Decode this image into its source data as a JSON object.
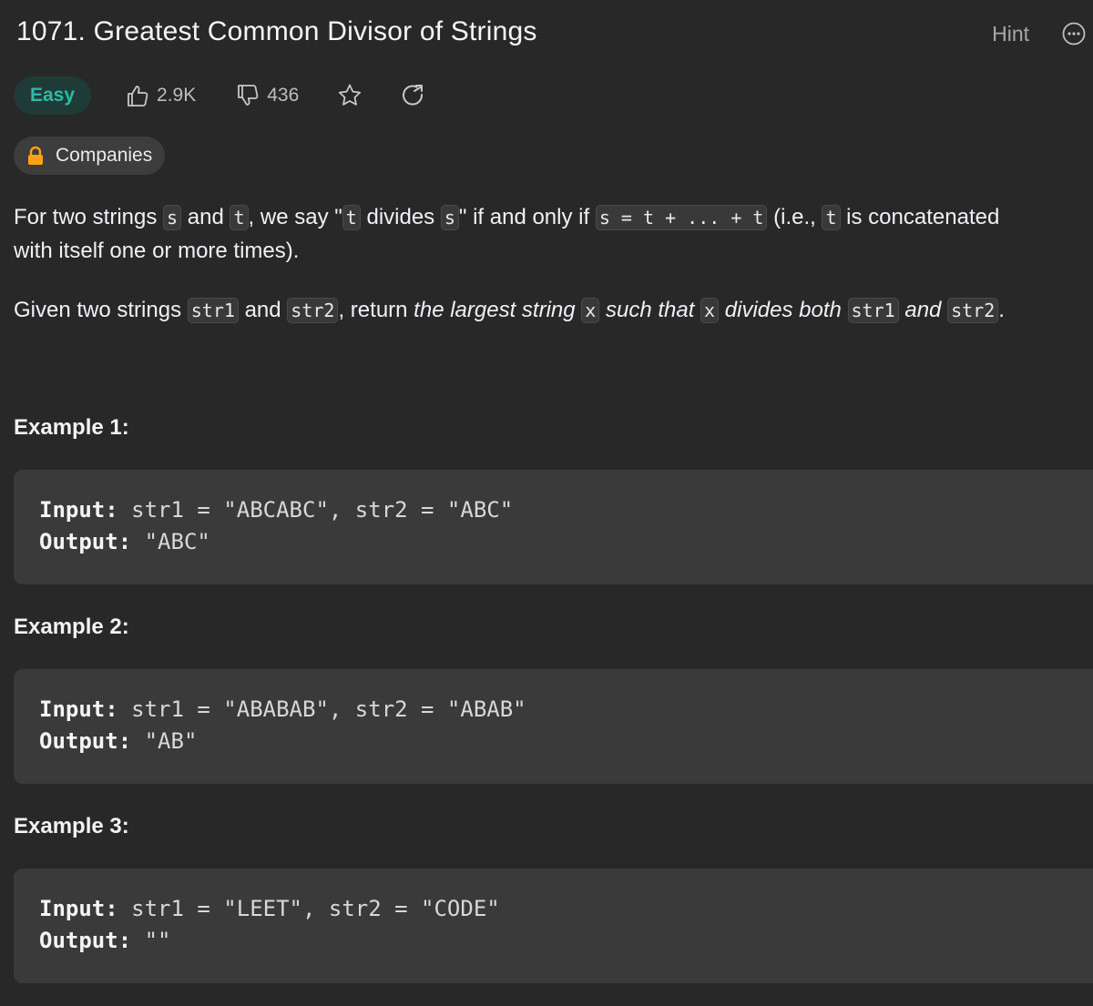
{
  "header": {
    "title": "1071. Greatest Common Divisor of Strings",
    "hint_label": "Hint",
    "more_icon": "more-icon"
  },
  "meta": {
    "difficulty": "Easy",
    "likes": "2.9K",
    "dislikes": "436",
    "icons": [
      "thumbs-up-icon",
      "thumbs-down-icon",
      "star-icon",
      "share-icon"
    ],
    "companies_label": "Companies",
    "colors": {
      "easy_text": "#2cbba6",
      "easy_bg": "#1f3b37",
      "lock": "#ffa116"
    }
  },
  "description": {
    "p1": [
      "For two strings ",
      "s",
      " and ",
      "t",
      ", we say \"",
      "t",
      " divides ",
      "s",
      "\" if and only if ",
      "s = t + ... + t",
      " (i.e., ",
      "t",
      " is concatenated"
    ],
    "p1_cont": "with itself one or more times).",
    "p2": [
      "Given two strings ",
      "str1",
      " and ",
      "str2",
      ", return ",
      "the largest string ",
      "x",
      " such that ",
      "x",
      " divides both ",
      "str1",
      " and ",
      "str2",
      "."
    ]
  },
  "examples": [
    {
      "title": "Example 1:",
      "input_label": "Input:",
      "input": " str1 = \"ABCABC\", str2 = \"ABC\"",
      "output_label": "Output:",
      "output": " \"ABC\""
    },
    {
      "title": "Example 2:",
      "input_label": "Input:",
      "input": " str1 = \"ABABAB\", str2 = \"ABAB\"",
      "output_label": "Output:",
      "output": " \"AB\""
    },
    {
      "title": "Example 3:",
      "input_label": "Input:",
      "input": " str1 = \"LEET\", str2 = \"CODE\"",
      "output_label": "Output:",
      "output": " \"\""
    }
  ]
}
